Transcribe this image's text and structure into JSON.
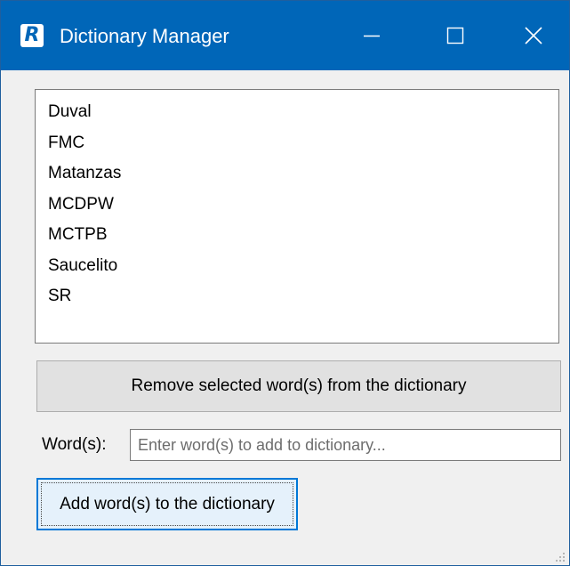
{
  "window": {
    "title": "Dictionary Manager",
    "app_icon_letter": "R",
    "controls": {
      "minimize_icon": "minimize-icon",
      "maximize_icon": "maximize-icon",
      "close_icon": "close-icon"
    }
  },
  "word_list": {
    "items": [
      "Duval",
      "FMC",
      "Matanzas",
      "MCDPW",
      "MCTPB",
      "Saucelito",
      "SR"
    ]
  },
  "remove_button": {
    "label": "Remove selected word(s) from the dictionary"
  },
  "word_input": {
    "label": "Word(s):",
    "value": "",
    "placeholder": "Enter word(s) to add to dictionary..."
  },
  "add_button": {
    "label": "Add word(s) to the dictionary"
  },
  "colors": {
    "titlebar": "#0066b8",
    "window_bg": "#f0f0f0",
    "focus_border": "#0078d7"
  }
}
